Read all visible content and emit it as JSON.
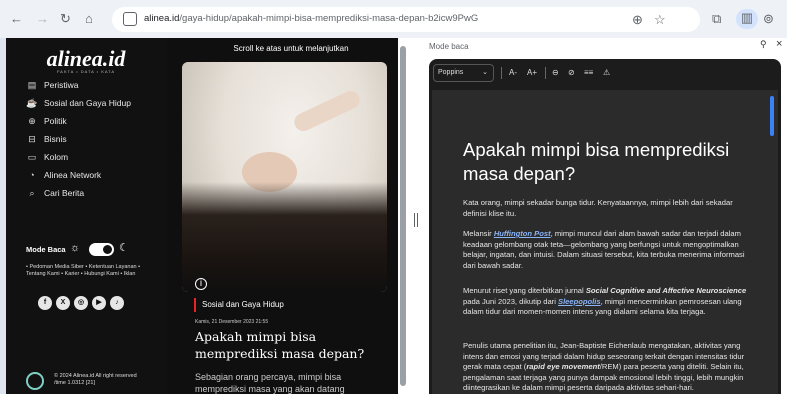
{
  "browser": {
    "url_domain": "alinea.id",
    "url_path": "/gaya-hidup/apakah-mimpi-bisa-memprediksi-masa-depan-b2icw9PwG"
  },
  "site": {
    "logo": "alinea.id",
    "tagline": "FAKTA • DATA • KATA",
    "menu": [
      {
        "label": "Peristiwa",
        "icon": "newspaper-icon"
      },
      {
        "label": "Sosial dan Gaya Hidup",
        "icon": "cup-icon"
      },
      {
        "label": "Politik",
        "icon": "globe-icon"
      },
      {
        "label": "Bisnis",
        "icon": "briefcase-icon"
      },
      {
        "label": "Kolom",
        "icon": "chat-icon"
      },
      {
        "label": "Alinea Network",
        "icon": "network-icon"
      },
      {
        "label": "Cari Berita",
        "icon": "search-icon"
      }
    ],
    "mode_label": "Mode Baca",
    "footer_links": "• Pedoman Media Siber • Ketentuan Layanan • Tentang Kami • Karier • Hubungi Kami • Iklan",
    "social": [
      "f",
      "X",
      "◎",
      "▶",
      "♪"
    ],
    "copyright": "© 2024 Alinea.id All right reserved",
    "build": "/time 1.0312 [21]"
  },
  "article": {
    "scroll_hint": "Scroll ke atas untuk melanjutkan",
    "category": "Sosial dan Gaya Hidup",
    "date": "Kamis, 21 Desember 2023 21:55",
    "title": "Apakah mimpi bisa memprediksi masa depan?",
    "lede": "Sebagian orang percaya, mimpi bisa memprediksi masa yang akan datang"
  },
  "reader": {
    "label": "Mode baca",
    "font": "Poppins",
    "tools": [
      "A-",
      "A+",
      "⊖",
      "⊘",
      "≡≡",
      "⚠"
    ],
    "title": "Apakah mimpi bisa memprediksi masa depan?",
    "paragraphs": [
      {
        "text": "Kata orang, mimpi sekadar bunga tidur. Kenyataannya, mimpi lebih dari sekadar definisi klise itu."
      },
      {
        "pre": "Melansir ",
        "link": "Huffington Post",
        "post": ", mimpi muncul dari alam bawah sadar dan terjadi dalam keadaan gelombang otak teta—gelombang yang berfungsi untuk mengoptimalkan belajar, ingatan, dan intuisi. Dalam situasi tersebut, kita terbuka menerima informasi dari bawah sadar."
      },
      {
        "pre": "Menurut riset yang diterbitkan jurnal ",
        "bold": "Social Cognitive and Affective Neuroscience",
        "mid": " pada Juni 2023, dikutip dari ",
        "link": "Sleepopolis",
        "post": ", mimpi mencerminkan pemrosesan ulang dalam tidur dari momen-momen intens yang dialami selama kita terjaga."
      },
      {
        "pre": "Penulis utama penelitian itu, Jean-Baptiste Eichenlaub mengatakan, aktivitas yang intens dan emosi yang terjadi dalam hidup seseorang terkait dengan intensitas tidur gerak mata cepat (",
        "bold": "rapid eye movement",
        "post": "/REM) para peserta yang diteliti. Selain itu, pengalaman saat terjaga yang punya dampak emosional lebih tinggi, lebih mungkin diintegrasikan ke dalam mimpi peserta daripada aktivitas sehari-hari."
      }
    ]
  }
}
